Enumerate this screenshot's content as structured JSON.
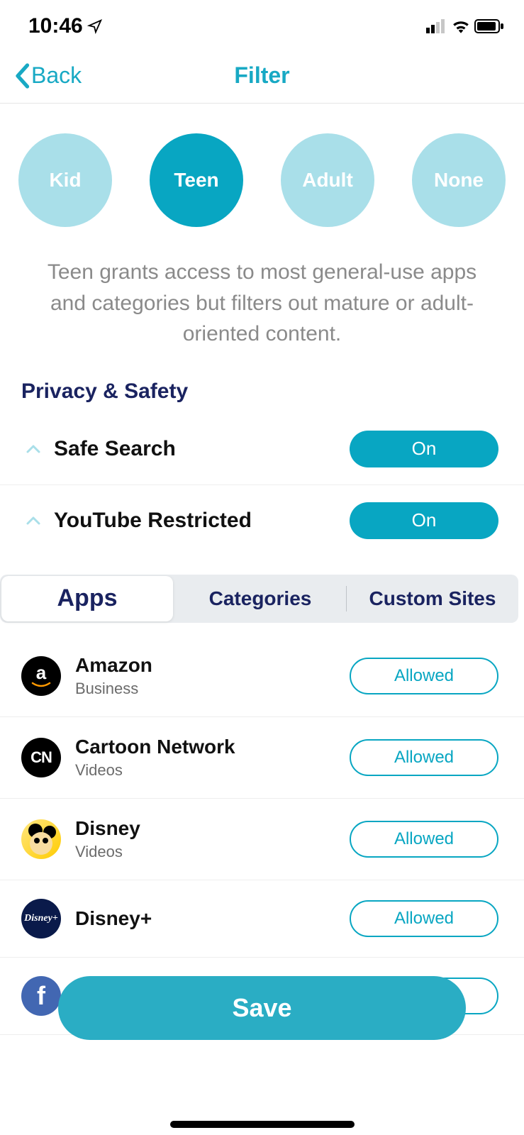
{
  "status_bar": {
    "time": "10:46"
  },
  "nav": {
    "back_label": "Back",
    "title": "Filter"
  },
  "filter_levels": {
    "options": [
      "Kid",
      "Teen",
      "Adult",
      "None"
    ],
    "active_index": 1,
    "description": "Teen grants access to most general-use apps and categories but filters out mature or adult-oriented content."
  },
  "privacy_safety": {
    "title": "Privacy & Safety",
    "rows": [
      {
        "label": "Safe Search",
        "value": "On"
      },
      {
        "label": "YouTube Restricted",
        "value": "On"
      }
    ]
  },
  "tabs": {
    "items": [
      "Apps",
      "Categories",
      "Custom Sites"
    ],
    "active_index": 0
  },
  "apps": [
    {
      "name": "Amazon",
      "category": "Business",
      "status": "Allowed",
      "icon": "amazon"
    },
    {
      "name": "Cartoon Network",
      "category": "Videos",
      "status": "Allowed",
      "icon": "cn"
    },
    {
      "name": "Disney",
      "category": "Videos",
      "status": "Allowed",
      "icon": "disney"
    },
    {
      "name": "Disney+",
      "category": "",
      "status": "Allowed",
      "icon": "disneyplus"
    },
    {
      "name": "Facebook",
      "category": "",
      "status": "Allowed",
      "icon": "fb"
    }
  ],
  "save_label": "Save",
  "colors": {
    "accent": "#08a6c2",
    "accent_light": "#a9dfe9",
    "nav_text": "#1a2360"
  }
}
